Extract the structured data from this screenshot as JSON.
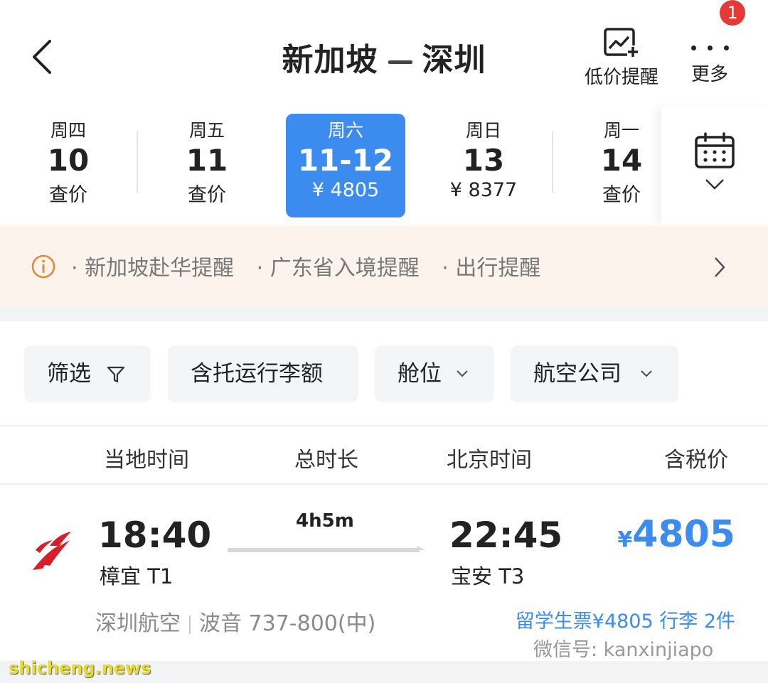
{
  "header": {
    "title_from": "新加坡",
    "title_to": "深圳",
    "price_alert_label": "低价提醒",
    "more_label": "更多",
    "badge_count": "1"
  },
  "dates": [
    {
      "weekday": "周四",
      "day": "10",
      "price": "查价",
      "selected": false
    },
    {
      "weekday": "周五",
      "day": "11",
      "price": "查价",
      "selected": false
    },
    {
      "weekday": "周六",
      "day": "11-12",
      "price": "¥ 4805",
      "selected": true
    },
    {
      "weekday": "周日",
      "day": "13",
      "price": "¥ 8377",
      "selected": false
    },
    {
      "weekday": "周一",
      "day": "14",
      "price": "查价",
      "selected": false
    }
  ],
  "notice": {
    "items": [
      "· 新加坡赴华提醒",
      "· 广东省入境提醒",
      "· 出行提醒"
    ]
  },
  "filters": {
    "filter": "筛选",
    "baggage": "含托运行李额",
    "cabin": "舱位",
    "airline": "航空公司"
  },
  "columns": {
    "local_time": "当地时间",
    "duration": "总时长",
    "beijing_time": "北京时间",
    "tax_price": "含税价"
  },
  "flight": {
    "dep_time": "18:40",
    "dep_airport": "樟宜 T1",
    "duration": "4h5m",
    "arr_time": "22:45",
    "arr_airport": "宝安 T3",
    "currency": "¥",
    "price": "4805",
    "airline": "深圳航空",
    "aircraft": "波音 737-800(中)",
    "fare_note": "留学生票¥4805 行李 2件"
  },
  "watermark": "微信号: kanxinjiapo",
  "site": "shicheng.news",
  "colors": {
    "accent": "#3c8cf0",
    "notice_bg": "#fcf3ec",
    "badge": "#e53935",
    "airline_logo": "#d81e2c"
  }
}
